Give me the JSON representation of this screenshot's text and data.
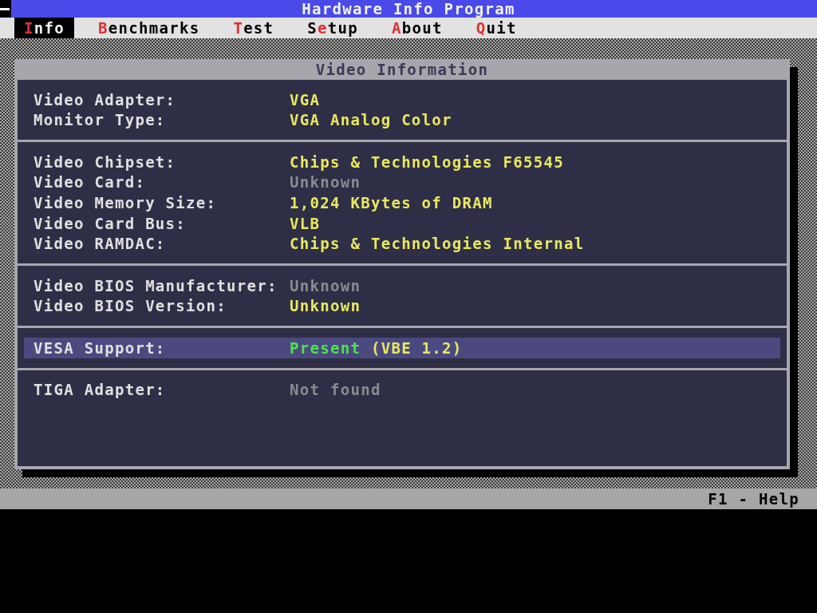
{
  "window": {
    "title": "Hardware Info Program"
  },
  "menu": [
    {
      "hotkey": "I",
      "after": "nfo",
      "selected": true
    },
    {
      "hotkey": "B",
      "after": "enchmarks",
      "selected": false
    },
    {
      "hotkey": "T",
      "after": "est",
      "selected": false
    },
    {
      "before": "S",
      "hotkey": "e",
      "after": "tup",
      "selected": false
    },
    {
      "hotkey": "A",
      "after": "bout",
      "selected": false
    },
    {
      "hotkey": "Q",
      "after": "uit",
      "selected": false
    }
  ],
  "panel": {
    "title": "Video Information",
    "groups": [
      {
        "rows": [
          {
            "label": "Video Adapter:",
            "selected": false,
            "value": [
              {
                "text": "VGA",
                "kind": "info"
              }
            ]
          },
          {
            "label": "Monitor Type:",
            "selected": false,
            "value": [
              {
                "text": "VGA Analog Color",
                "kind": "info"
              }
            ]
          }
        ]
      },
      {
        "rows": [
          {
            "label": "Video Chipset:",
            "selected": false,
            "value": [
              {
                "text": "Chips & Technologies F65545",
                "kind": "info"
              }
            ]
          },
          {
            "label": "Video Card:",
            "selected": false,
            "value": [
              {
                "text": "Unknown",
                "kind": "unknown"
              }
            ]
          },
          {
            "label": "Video Memory Size:",
            "selected": false,
            "value": [
              {
                "text": "1,024 KBytes of DRAM",
                "kind": "info"
              }
            ]
          },
          {
            "label": "Video Card Bus:",
            "selected": false,
            "value": [
              {
                "text": "VLB",
                "kind": "info"
              }
            ]
          },
          {
            "label": "Video RAMDAC:",
            "selected": false,
            "value": [
              {
                "text": "Chips & Technologies Internal",
                "kind": "info"
              }
            ]
          }
        ]
      },
      {
        "rows": [
          {
            "label": "Video BIOS Manufacturer:",
            "selected": false,
            "value": [
              {
                "text": "Unknown",
                "kind": "unknown"
              }
            ]
          },
          {
            "label": "Video BIOS Version:",
            "selected": false,
            "value": [
              {
                "text": "Unknown",
                "kind": "info"
              }
            ]
          }
        ]
      },
      {
        "rows": [
          {
            "label": "VESA Support:",
            "selected": true,
            "value": [
              {
                "text": "Present",
                "kind": "ok"
              },
              {
                "text": " (VBE 1.2)",
                "kind": "info"
              }
            ]
          }
        ]
      },
      {
        "rows": [
          {
            "label": "TIGA Adapter:",
            "selected": false,
            "value": [
              {
                "text": "Not found",
                "kind": "unknown"
              }
            ]
          }
        ]
      }
    ]
  },
  "status_bar": {
    "help": "F1 - Help"
  }
}
